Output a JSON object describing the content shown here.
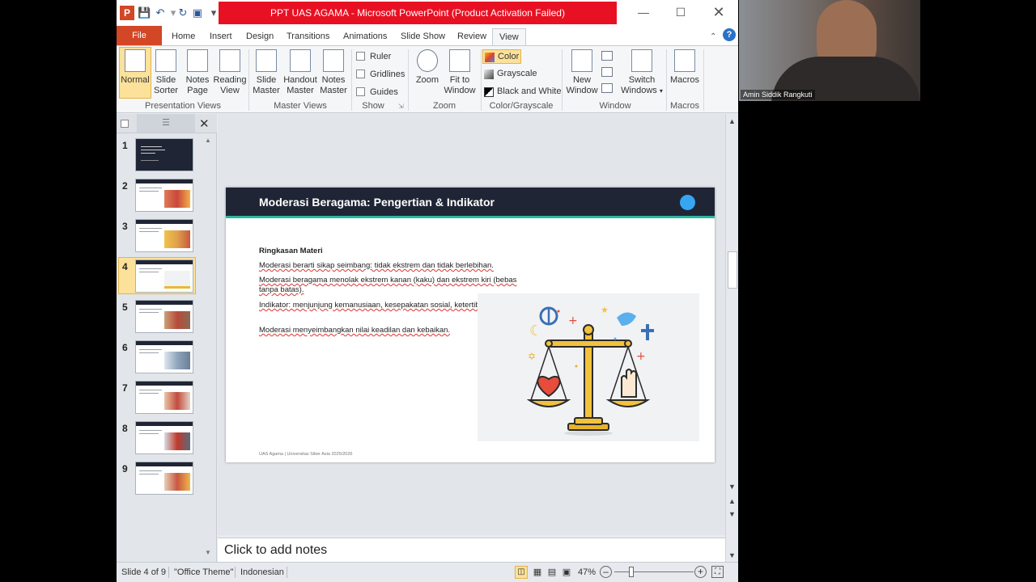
{
  "window": {
    "title": "PPT UAS AGAMA - Microsoft PowerPoint (Product Activation Failed)",
    "controls": [
      "minimize",
      "maximize",
      "close"
    ]
  },
  "tabs": [
    "File",
    "Home",
    "Insert",
    "Design",
    "Transitions",
    "Animations",
    "Slide Show",
    "Review",
    "View"
  ],
  "active_tab": "View",
  "ribbon": {
    "presentation_views": {
      "label": "Presentation Views",
      "buttons": [
        {
          "line1": "Normal",
          "line2": ""
        },
        {
          "line1": "Slide",
          "line2": "Sorter"
        },
        {
          "line1": "Notes",
          "line2": "Page"
        },
        {
          "line1": "Reading",
          "line2": "View"
        }
      ]
    },
    "master_views": {
      "label": "Master Views",
      "buttons": [
        {
          "line1": "Slide",
          "line2": "Master"
        },
        {
          "line1": "Handout",
          "line2": "Master"
        },
        {
          "line1": "Notes",
          "line2": "Master"
        }
      ]
    },
    "show": {
      "label": "Show",
      "checkboxes": [
        "Ruler",
        "Gridlines",
        "Guides"
      ]
    },
    "zoom": {
      "label": "Zoom",
      "buttons": [
        {
          "line1": "Zoom",
          "line2": ""
        },
        {
          "line1": "Fit to",
          "line2": "Window"
        }
      ]
    },
    "color_grayscale": {
      "label": "Color/Grayscale",
      "options": [
        "Color",
        "Grayscale",
        "Black and White"
      ]
    },
    "window": {
      "label": "Window",
      "buttons": [
        {
          "line1": "New",
          "line2": "Window"
        },
        {
          "line1": "Switch",
          "line2": "Windows"
        }
      ]
    },
    "macros": {
      "label": "Macros",
      "buttons": [
        {
          "line1": "Macros",
          "line2": ""
        }
      ]
    }
  },
  "thumbnails": {
    "numbers": [
      "1",
      "2",
      "3",
      "4",
      "5",
      "6",
      "7",
      "8",
      "9"
    ],
    "selected": "4"
  },
  "slide": {
    "title": "Moderasi Beragama: Pengertian & Indikator",
    "heading": "Ringkasan Materi",
    "bullets": [
      "Moderasi berarti sikap seimbang: tidak ekstrem dan tidak berlebihan.",
      "Moderasi beragama menolak ekstrem kanan (kaku) dan ekstrem kiri (bebas tanpa batas).",
      "Indikator: menjunjung kemanusiaan, kesepakatan sosial, ketertiban umum.",
      "Moderasi menyeimbangkan nilai keadilan dan kebaikan."
    ],
    "footer": "UAS Agama | Universitas Siber Asia 2025/2026"
  },
  "notes_placeholder": "Click to add notes",
  "status": {
    "slide_info": "Slide 4 of 9",
    "theme": "\"Office Theme\"",
    "language": "Indonesian",
    "zoom": "47%"
  },
  "webcam": {
    "name": "Amin Siddik Rangkuti"
  },
  "colors": {
    "title_bar_alert": "#e81123",
    "file_tab": "#d24726",
    "slide_header": "#1f2535",
    "slide_accent": "#2bb5a3",
    "slide_dot": "#36a6f2",
    "selected_highlight": "#fbe19a"
  }
}
